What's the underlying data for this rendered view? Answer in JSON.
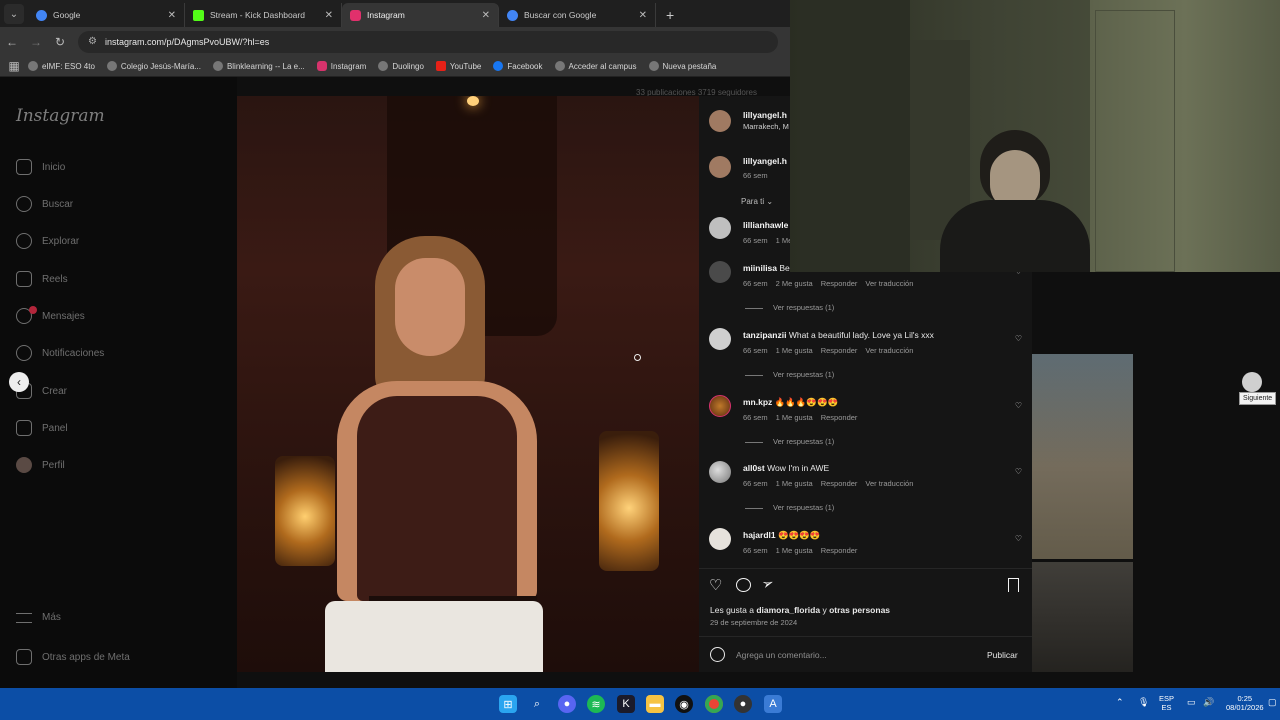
{
  "browser": {
    "tabs": [
      {
        "title": "Google",
        "favicon_color": "#4285f4"
      },
      {
        "title": "Stream - Kick Dashboard",
        "favicon_color": "#53fc18"
      },
      {
        "title": "Instagram",
        "favicon_color": "#e1306c"
      },
      {
        "title": "Buscar con Google",
        "favicon_color": "#4285f4"
      }
    ],
    "address": "instagram.com/p/DAgmsPvoUBW/?hl=es",
    "bookmarks": [
      "eIMF: ESO 4to",
      "Colegio Jesús-María...",
      "Blinklearning -- La e...",
      "Instagram",
      "Duolingo",
      "YouTube",
      "Facebook",
      "Acceder al campus",
      "Nueva pestaña"
    ]
  },
  "instagram": {
    "logo": "Instagram",
    "nav": [
      {
        "label": "Inicio",
        "icon": "home-icon"
      },
      {
        "label": "Buscar",
        "icon": "search-icon"
      },
      {
        "label": "Explorar",
        "icon": "compass-icon"
      },
      {
        "label": "Reels",
        "icon": "reels-icon"
      },
      {
        "label": "Mensajes",
        "icon": "messenger-icon"
      },
      {
        "label": "Notificaciones",
        "icon": "heart-icon"
      },
      {
        "label": "Crear",
        "icon": "plus-icon"
      },
      {
        "label": "Panel",
        "icon": "chart-icon"
      },
      {
        "label": "Perfil",
        "icon": "avatar-icon"
      }
    ],
    "more": "Más",
    "meta_apps": "Otras apps de Meta",
    "profile_stats": "33 publicaciones   3719 seguidores",
    "next_tooltip": "Siguiente"
  },
  "post": {
    "author": "lillyangel.h",
    "location": "Marrakech, M",
    "caption_author": "lillyangel.h",
    "caption_time": "66 sem",
    "sort": "Para ti",
    "comments": [
      {
        "user": "lillianhawle",
        "text": "",
        "time": "66 sem",
        "likes": "1 Me",
        "actions": [],
        "replies": ""
      },
      {
        "user": "miinilisa",
        "text": "Be",
        "time": "66 sem",
        "likes": "2 Me gusta",
        "actions": [
          "Responder",
          "Ver traducción"
        ],
        "replies": "Ver respuestas (1)"
      },
      {
        "user": "tanzipanzii",
        "text": "What a beautiful lady. Love ya Lil's xxx",
        "time": "66 sem",
        "likes": "1 Me gusta",
        "actions": [
          "Responder",
          "Ver traducción"
        ],
        "replies": "Ver respuestas (1)"
      },
      {
        "user": "mn.kpz",
        "text": "🔥🔥🔥😍😍😍",
        "time": "66 sem",
        "likes": "1 Me gusta",
        "actions": [
          "Responder"
        ],
        "replies": "Ver respuestas (1)"
      },
      {
        "user": "all0st",
        "text": "Wow I'm in AWE",
        "time": "66 sem",
        "likes": "1 Me gusta",
        "actions": [
          "Responder",
          "Ver traducción"
        ],
        "replies": "Ver respuestas (1)"
      },
      {
        "user": "hajardl1",
        "text": "😍😍😍😍",
        "time": "66 sem",
        "likes": "1 Me gusta",
        "actions": [
          "Responder"
        ],
        "replies": ""
      }
    ],
    "likes_prefix": "Les gusta a ",
    "likes_user": "diamora_florida",
    "likes_mid": " y ",
    "likes_others": "otras personas",
    "date": "29 de septiembre de 2024",
    "comment_placeholder": "Agrega un comentario...",
    "publish": "Publicar"
  },
  "taskbar": {
    "lang_top": "ESP",
    "lang_bottom": "ES",
    "time": "0:25",
    "date": "08/01/2026"
  }
}
